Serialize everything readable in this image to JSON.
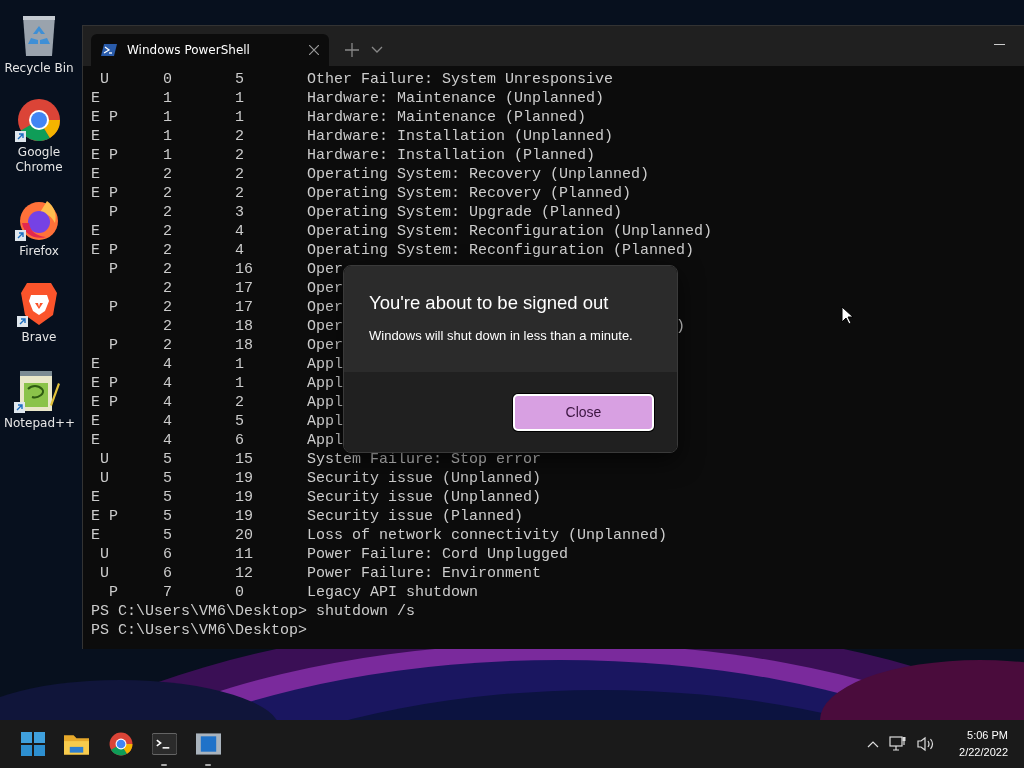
{
  "desktop_icons": [
    {
      "kind": "bin",
      "label": "Recycle Bin",
      "shortcut": false
    },
    {
      "kind": "ring",
      "label": "Google Chrome",
      "shortcut": true
    },
    {
      "kind": "fox",
      "label": "Firefox",
      "shortcut": true
    },
    {
      "kind": "lion",
      "label": "Brave",
      "shortcut": true
    },
    {
      "kind": "notepad",
      "label": "Notepad++",
      "shortcut": true
    }
  ],
  "terminal": {
    "tabs": [
      {
        "title": "Windows PowerShell",
        "selected": true
      }
    ],
    "lines": [
      {
        "flags": " U",
        "c1": "0",
        "c2": "5",
        "desc": "Other Failure: System Unresponsive"
      },
      {
        "flags": "E",
        "c1": "1",
        "c2": "1",
        "desc": "Hardware: Maintenance (Unplanned)"
      },
      {
        "flags": "E P",
        "c1": "1",
        "c2": "1",
        "desc": "Hardware: Maintenance (Planned)"
      },
      {
        "flags": "E",
        "c1": "1",
        "c2": "2",
        "desc": "Hardware: Installation (Unplanned)"
      },
      {
        "flags": "E P",
        "c1": "1",
        "c2": "2",
        "desc": "Hardware: Installation (Planned)"
      },
      {
        "flags": "E",
        "c1": "2",
        "c2": "2",
        "desc": "Operating System: Recovery (Unplanned)"
      },
      {
        "flags": "E P",
        "c1": "2",
        "c2": "2",
        "desc": "Operating System: Recovery (Planned)"
      },
      {
        "flags": "  P",
        "c1": "2",
        "c2": "3",
        "desc": "Operating System: Upgrade (Planned)"
      },
      {
        "flags": "E",
        "c1": "2",
        "c2": "4",
        "desc": "Operating System: Reconfiguration (Unplanned)"
      },
      {
        "flags": "E P",
        "c1": "2",
        "c2": "4",
        "desc": "Operating System: Reconfiguration (Planned)"
      },
      {
        "flags": "  P",
        "c1": "2",
        "c2": "16",
        "desc": "Oper"
      },
      {
        "c1": "2",
        "c2": "17",
        "desc": "Oper"
      },
      {
        "flags": "  P",
        "c1": "2",
        "c2": "17",
        "desc": "Oper"
      },
      {
        "c1": "2",
        "c2": "18",
        "desc": "Oper",
        "tail": ")"
      },
      {
        "flags": "  P",
        "c1": "2",
        "c2": "18",
        "desc": "Oper"
      },
      {
        "flags": "E",
        "c1": "4",
        "c2": "1",
        "desc": "Appl"
      },
      {
        "flags": "E P",
        "c1": "4",
        "c2": "1",
        "desc": "Appl"
      },
      {
        "flags": "E P",
        "c1": "4",
        "c2": "2",
        "desc": "Appl"
      },
      {
        "flags": "E",
        "c1": "4",
        "c2": "5",
        "desc": "Appl"
      },
      {
        "flags": "E",
        "c1": "4",
        "c2": "6",
        "desc": "Appl"
      },
      {
        "flags": " U",
        "c1": "5",
        "c2": "15",
        "desc": "System Failure: Stop error"
      },
      {
        "flags": " U",
        "c1": "5",
        "c2": "19",
        "desc": "Security issue (Unplanned)"
      },
      {
        "flags": "E",
        "c1": "5",
        "c2": "19",
        "desc": "Security issue (Unplanned)"
      },
      {
        "flags": "E P",
        "c1": "5",
        "c2": "19",
        "desc": "Security issue (Planned)"
      },
      {
        "flags": "E",
        "c1": "5",
        "c2": "20",
        "desc": "Loss of network connectivity (Unplanned)"
      },
      {
        "flags": " U",
        "c1": "6",
        "c2": "11",
        "desc": "Power Failure: Cord Unplugged"
      },
      {
        "flags": " U",
        "c1": "6",
        "c2": "12",
        "desc": "Power Failure: Environment"
      },
      {
        "flags": "  P",
        "c1": "7",
        "c2": "0",
        "desc": "Legacy API shutdown"
      }
    ],
    "prompts": [
      {
        "prompt": "PS C:\\Users\\VM6\\Desktop>",
        "command": "shutdown /s"
      },
      {
        "prompt": "PS C:\\Users\\VM6\\Desktop>"
      }
    ]
  },
  "dialog": {
    "title": "You're about to be signed out",
    "message": "Windows will shut down in less than a minute.",
    "button": "Close"
  },
  "taskbar": {
    "apps": [
      {
        "kind": "start",
        "running": false
      },
      {
        "kind": "folder",
        "running": false
      },
      {
        "kind": "ring",
        "running": false
      },
      {
        "kind": "terminal",
        "running": true
      },
      {
        "kind": "window",
        "running": true
      }
    ],
    "time": "5:06 PM",
    "date": "2/22/2022"
  }
}
